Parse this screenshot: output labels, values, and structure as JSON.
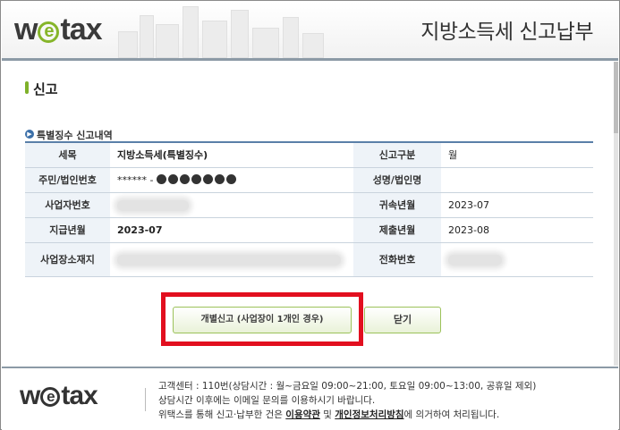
{
  "header": {
    "logo_left": "w",
    "logo_e": "e",
    "logo_right": "tax",
    "title": "지방소득세 신고납부"
  },
  "section": {
    "title": "신고",
    "subtitle": "특별징수 신고내역"
  },
  "table": {
    "r1": {
      "l1": "세목",
      "v1": "지방소득세(특별징수)",
      "l2": "신고구분",
      "v2": "월"
    },
    "r2": {
      "l1": "주민/법인번호",
      "v1": "****** -",
      "l2": "성명/법인명",
      "v2": ""
    },
    "r3": {
      "l1": "사업자번호",
      "v1": "",
      "l2": "귀속년월",
      "v2": "2023-07"
    },
    "r4": {
      "l1": "지급년월",
      "v1": "2023-07",
      "l2": "제출년월",
      "v2": "2023-08"
    },
    "r5": {
      "l1": "사업장소재지",
      "v1": "",
      "l2": "전화번호",
      "v2": ""
    }
  },
  "buttons": {
    "individual": "개별신고 (사업장이 1개인 경우)",
    "close": "닫기"
  },
  "footer": {
    "logo_left": "w",
    "logo_e": "e",
    "logo_right": "tax",
    "line1": "고객센터 : 110번(상담시간 : 월~금요일 09:00~21:00, 토요일 09:00~13:00, 공휴일 제외)",
    "line2": "상담시간 이후에는 이메일 문의를 이용하시기 바랍니다.",
    "line3_pre": "위택스를 통해 신고·납부한 건은 ",
    "terms_link": "이용약관",
    "line3_mid": " 및 ",
    "privacy_link": "개인정보처리방침",
    "line3_post": "에 의거하여 처리됩니다."
  },
  "colors": {
    "accent_green": "#86b52a",
    "highlight_red": "#e20f1f",
    "table_header_bg": "#eef3f8",
    "table_top_border": "#5a7fa8"
  }
}
